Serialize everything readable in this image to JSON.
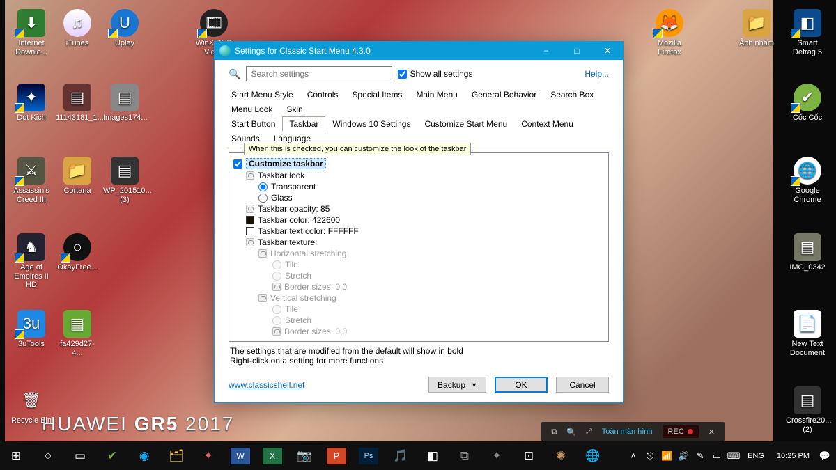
{
  "window": {
    "title": "Settings for Classic Start Menu 4.3.0",
    "search_placeholder": "Search settings",
    "show_all_label": "Show all settings",
    "help_label": "Help...",
    "tabs_row1": [
      "Start Menu Style",
      "Controls",
      "Special Items",
      "Main Menu",
      "General Behavior",
      "Search Box",
      "Menu Look",
      "Skin"
    ],
    "tabs_row2": [
      "Start Button",
      "Taskbar",
      "Windows 10 Settings",
      "Customize Start Menu",
      "Context Menu",
      "Sounds",
      "Language"
    ],
    "active_tab": "Taskbar",
    "root_checkbox_label": "Customize taskbar",
    "taskbar_look_label": "Taskbar look",
    "tooltip": "When this is checked, you can customize the look of the taskbar",
    "radio_transparent": "Transparent",
    "radio_glass": "Glass",
    "opacity_label": "Taskbar opacity: 85",
    "color_label": "Taskbar color: 422600",
    "textcolor_label": "Taskbar text color: FFFFFF",
    "texture_label": "Taskbar texture:",
    "hstretch": "Horizontal stretching",
    "tile": "Tile",
    "stretch": "Stretch",
    "border": "Border sizes: 0,0",
    "vstretch": "Vertical stretching",
    "note1": "The settings that are modified from the default will show in bold",
    "note2": "Right-click on a setting for more functions",
    "link": "www.classicshell.net",
    "backup": "Backup",
    "ok": "OK",
    "cancel": "Cancel"
  },
  "desktop_icons": {
    "col1": [
      {
        "label": "Internet Downlo...",
        "bg": "#2e7d32"
      },
      {
        "label": "Dot Kich",
        "bg": "#0b4a8c"
      },
      {
        "label": "Assassin's Creed III",
        "bg": "#554"
      },
      {
        "label": "Age of Empires II HD",
        "bg": "#223"
      },
      {
        "label": "3uTools",
        "bg": "#1e88e5"
      },
      {
        "label": "Recycle Bin",
        "bg": "#9ab"
      }
    ],
    "col2": [
      {
        "label": "iTunes",
        "bg": "#cfd0ff"
      },
      {
        "label": "11143181_1...",
        "bg": "#633"
      },
      {
        "label": "Cortana",
        "bg": "#d9a441"
      },
      {
        "label": "OkayFree...",
        "bg": "#111"
      },
      {
        "label": "fa429d27-4...",
        "bg": "#6a3"
      }
    ],
    "col3": [
      {
        "label": "Uplay",
        "bg": "#1976d2"
      },
      {
        "label": "Images174...",
        "bg": "#888"
      },
      {
        "label": "WP_201510... (3)",
        "bg": "#333"
      }
    ],
    "col4": [
      {
        "label": "WinX DVD Video",
        "bg": "#222"
      }
    ],
    "right": [
      {
        "label": "Mozilla Firefox",
        "bg": "#ff9800"
      },
      {
        "label": "Ảnh nhâm",
        "bg": "#d9a441"
      },
      {
        "label": "Smart Defrag 5",
        "bg": "#0b4a8c"
      },
      {
        "label": "Cốc Cốc",
        "bg": "#7cb342"
      },
      {
        "label": "Google Chrome",
        "bg": "#fff"
      },
      {
        "label": "IMG_0342",
        "bg": "#776"
      },
      {
        "label": "New Text Document",
        "bg": "#eee"
      },
      {
        "label": "Crossfire20... (2)",
        "bg": "#333"
      }
    ]
  },
  "taskbar": {
    "lang": "ENG",
    "time": "10:25 PM"
  },
  "overlay": {
    "fullscreen": "Toàn màn hình",
    "rec": "REC"
  },
  "wallmark": "HUAWEI GR5 2017"
}
